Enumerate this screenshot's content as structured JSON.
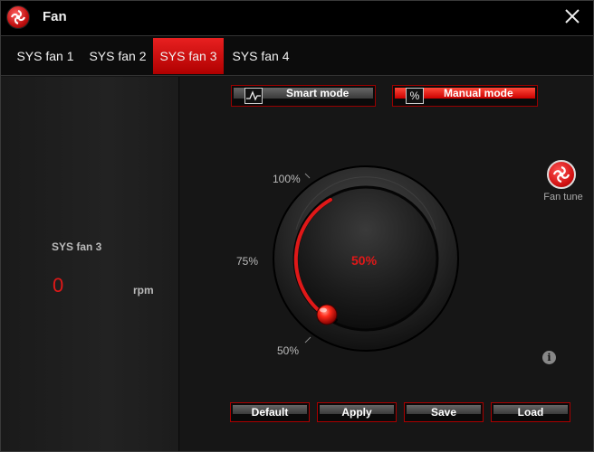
{
  "window": {
    "title": "Fan",
    "logo_icon": "msi-dragon-logo-icon",
    "close_icon": "close-icon"
  },
  "tabs": [
    {
      "label": "SYS fan 1",
      "active": false
    },
    {
      "label": "SYS fan 2",
      "active": false
    },
    {
      "label": "SYS fan 3",
      "active": true
    },
    {
      "label": "SYS fan 4",
      "active": false
    }
  ],
  "status": {
    "fan_name": "SYS fan 3",
    "rpm_value": "0",
    "rpm_unit": "rpm"
  },
  "modes": {
    "smart": {
      "label": "Smart mode",
      "icon": "curve-graph-icon",
      "selected": false
    },
    "manual": {
      "label": "Manual mode",
      "icon": "percent-icon",
      "icon_text": "%",
      "selected": true
    }
  },
  "dial": {
    "ticks": {
      "top": "100%",
      "middle": "75%",
      "bottom": "50%"
    },
    "value_text": "50%",
    "value": 50,
    "min": 50,
    "max": 100
  },
  "fan_tune": {
    "label": "Fan tune",
    "icon": "fan-tune-icon"
  },
  "info_icon": {
    "icon": "info-icon",
    "text": "i"
  },
  "actions": {
    "default": "Default",
    "apply": "Apply",
    "save": "Save",
    "load": "Load"
  },
  "colors": {
    "accent": "#e01818",
    "active_tab": "#d01010",
    "background": "#141414"
  }
}
